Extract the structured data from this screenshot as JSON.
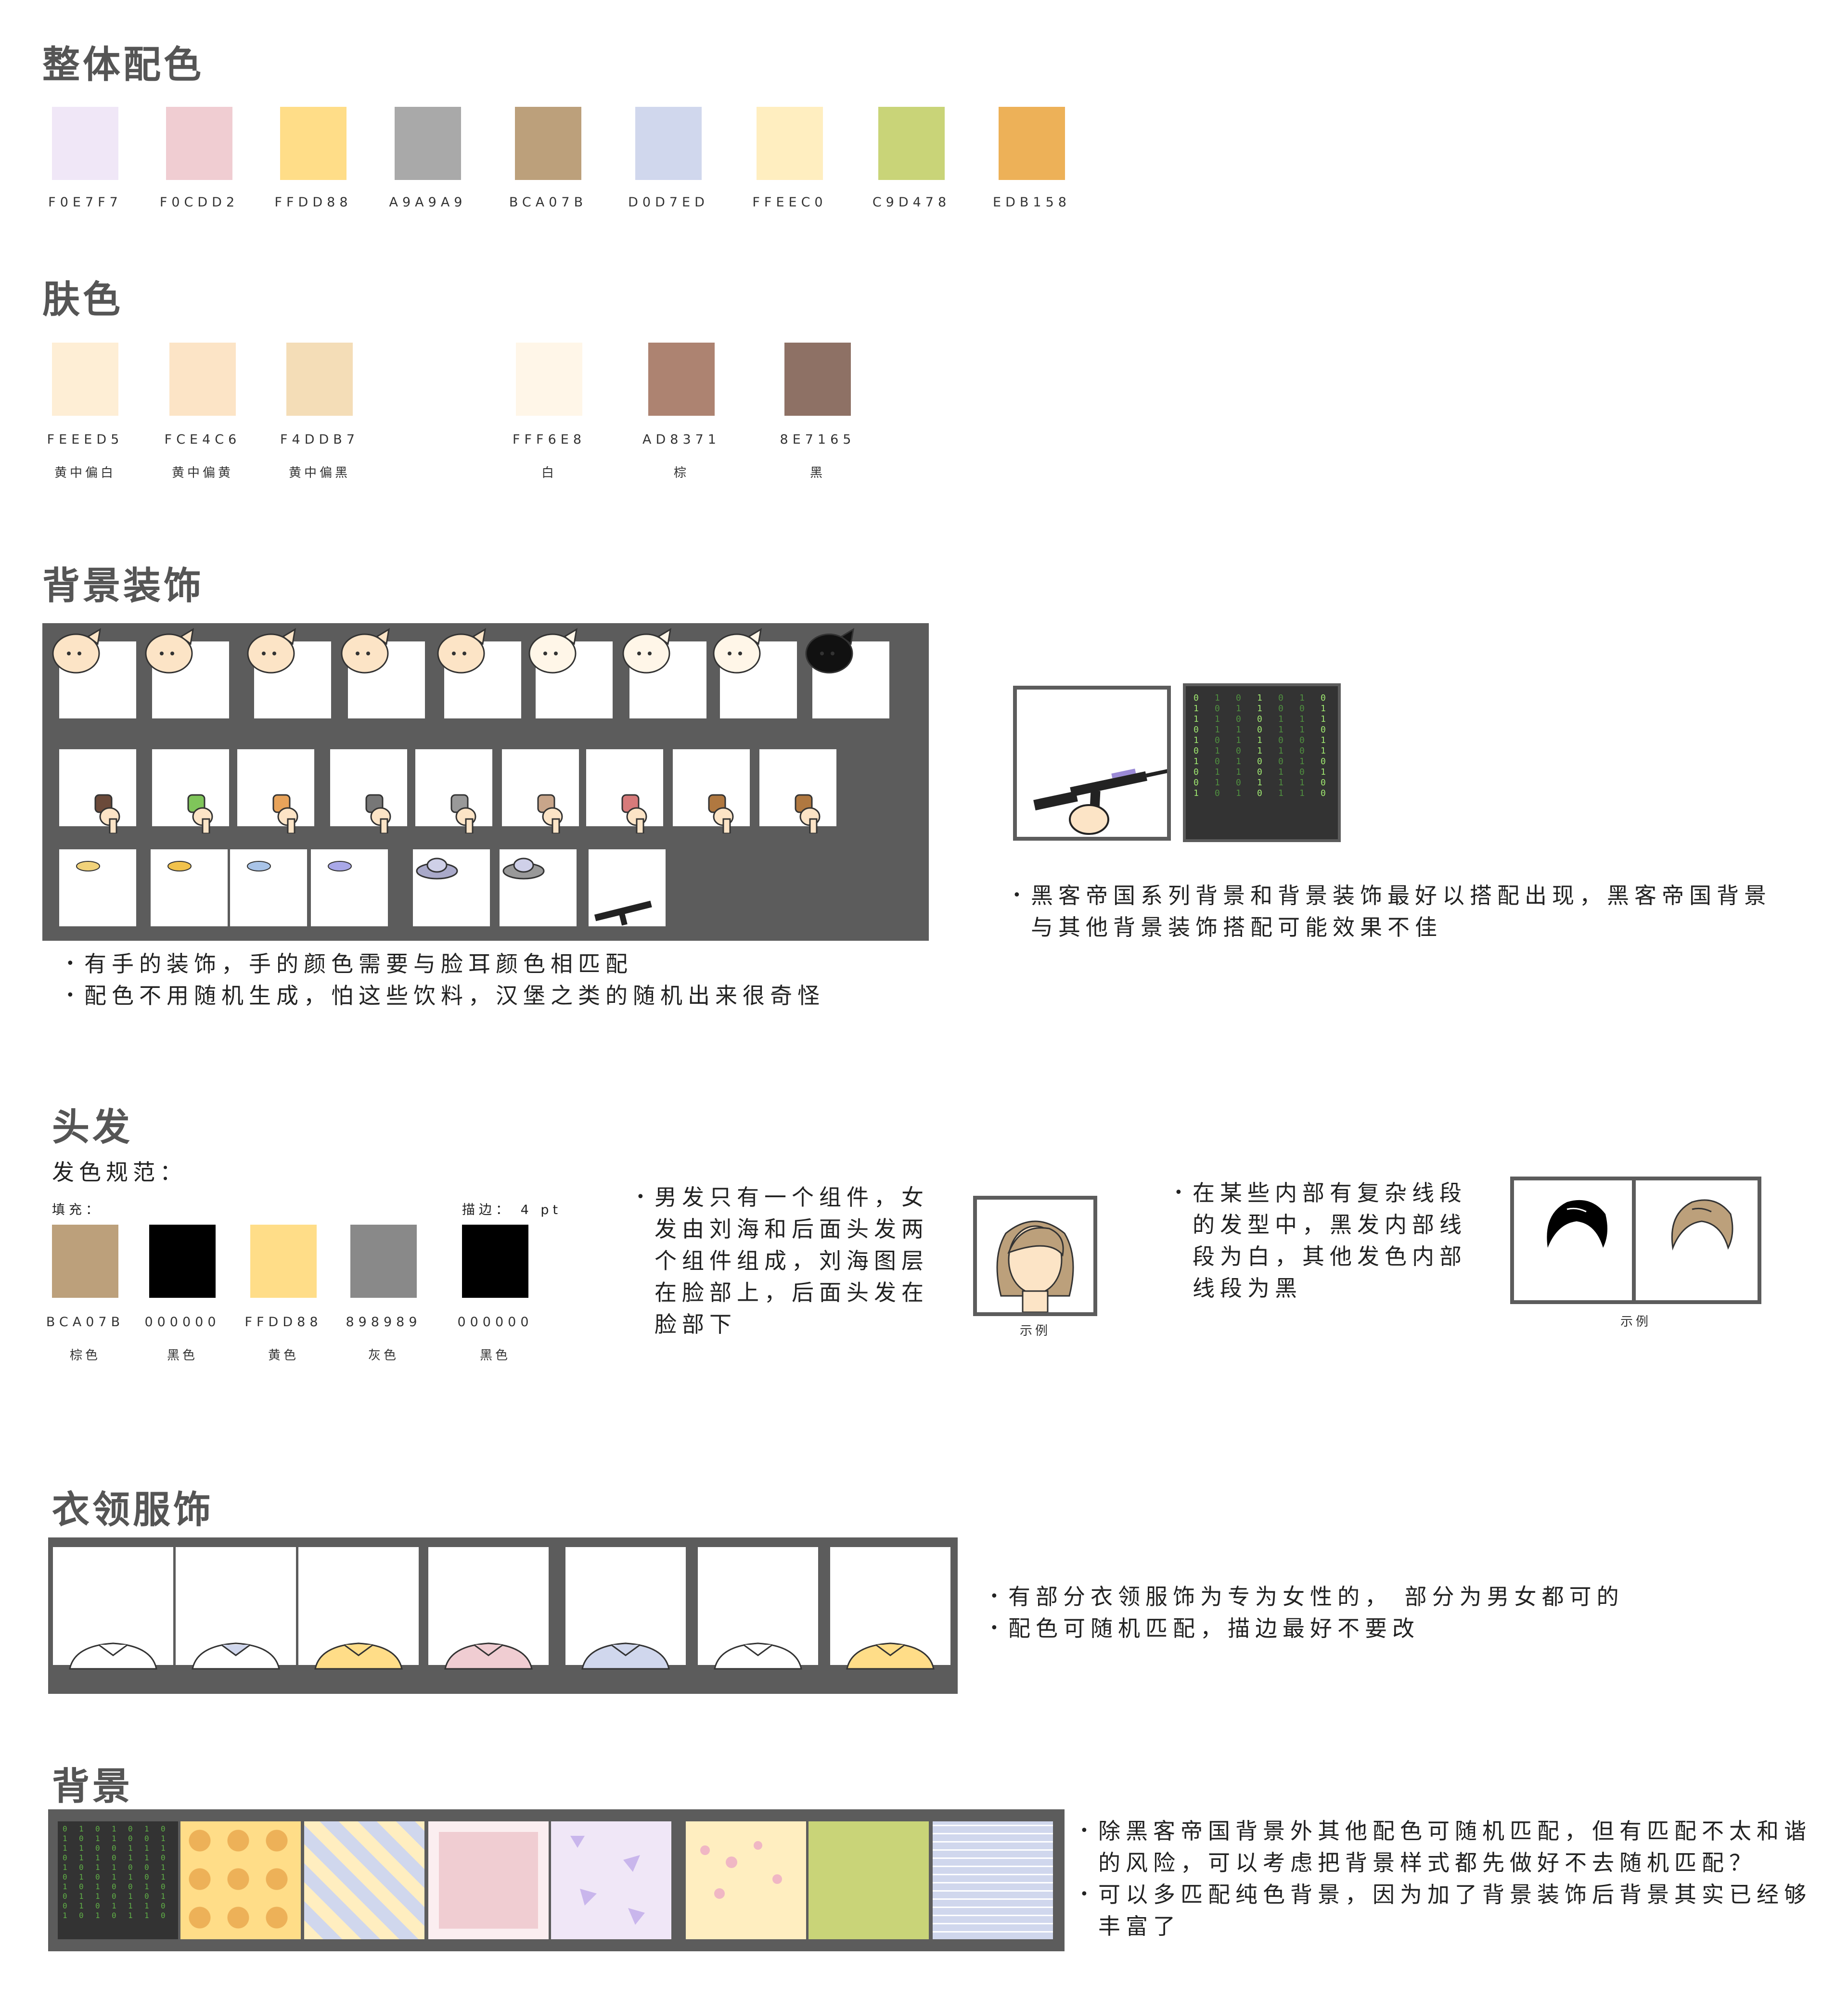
{
  "overall": {
    "title": "整体配色",
    "swatches": [
      {
        "code": "F0E7F7",
        "color": "#F0E7F7"
      },
      {
        "code": "F0CDD2",
        "color": "#F0CDD2"
      },
      {
        "code": "FFDD88",
        "color": "#FFDD88"
      },
      {
        "code": "A9A9A9",
        "color": "#A9A9A9"
      },
      {
        "code": "BCA07B",
        "color": "#BCA07B"
      },
      {
        "code": "D0D7ED",
        "color": "#D0D7ED"
      },
      {
        "code": "FFEEC0",
        "color": "#FFEEC0"
      },
      {
        "code": "C9D478",
        "color": "#C9D478"
      },
      {
        "code": "EDB158",
        "color": "#EDB158"
      }
    ]
  },
  "skin": {
    "title": "肤色",
    "swatches": [
      {
        "code": "FEEED5",
        "label": "黄中偏白",
        "color": "#FEEED5"
      },
      {
        "code": "FCE4C6",
        "label": "黄中偏黄",
        "color": "#FCE4C6"
      },
      {
        "code": "F4DDB7",
        "label": "黄中偏黑",
        "color": "#F4DDB7"
      },
      {
        "code": "FFF6E8",
        "label": "白",
        "color": "#FFF6E8"
      },
      {
        "code": "AD8371",
        "label": "棕",
        "color": "#AD8371"
      },
      {
        "code": "8E7165",
        "label": "黑",
        "color": "#8E7165"
      }
    ]
  },
  "decor": {
    "title": "背景装饰",
    "notes": [
      "有手的装饰，手的颜色需要与脸耳颜色相匹配",
      "配色不用随机生成，怕这些饮料，汉堡之类的随机出来很奇怪"
    ],
    "hacker_note": [
      "黑客帝国系列背景和背景装饰最好以搭配出现，黑客帝国背景",
      "与其他背景装饰搭配可能效果不佳"
    ]
  },
  "hair": {
    "title": "头发",
    "spec_title": "发色规范：",
    "fill_label": "填充：",
    "stroke_label": "描边： 4 pt",
    "swatches": [
      {
        "code": "BCA07B",
        "label": "棕色",
        "color": "#BCA07B"
      },
      {
        "code": "000000",
        "label": "黑色",
        "color": "#000000"
      },
      {
        "code": "FFDD88",
        "label": "黄色",
        "color": "#FFDD88"
      },
      {
        "code": "898989",
        "label": "灰色",
        "color": "#898989"
      }
    ],
    "stroke_swatch": {
      "code": "000000",
      "label": "黑色",
      "color": "#000000"
    },
    "note1": [
      "男发只有一个组件，女",
      "发由刘海和后面头发两",
      "个组件组成，刘海图层",
      "在脸部上，后面头发在",
      "脸部下"
    ],
    "note2": [
      "在某些内部有复杂线段",
      "的发型中，黑发内部线",
      "段为白，其他发色内部",
      "线段为黑"
    ],
    "example_label": "示例"
  },
  "collar": {
    "title": "衣领服饰",
    "notes": [
      "有部分衣领服饰为专为女性的， 部分为男女都可的",
      "配色可随机匹配，描边最好不要改"
    ]
  },
  "background": {
    "title": "背景",
    "notes": [
      [
        "除黑客帝国背景外其他配色可随机匹配，但有匹配不太和谐",
        "的风险，可以考虑把背景样式都先做好不去随机匹配？"
      ],
      [
        "可以多匹配纯色背景，因为加了背景装饰后背景其实已经够",
        "丰富了"
      ]
    ]
  },
  "matrix_digits": [
    "0110101001",
    "1011010110",
    "0101101101",
    "1100110010",
    "0011010111",
    "1011001011",
    "0110110100"
  ]
}
